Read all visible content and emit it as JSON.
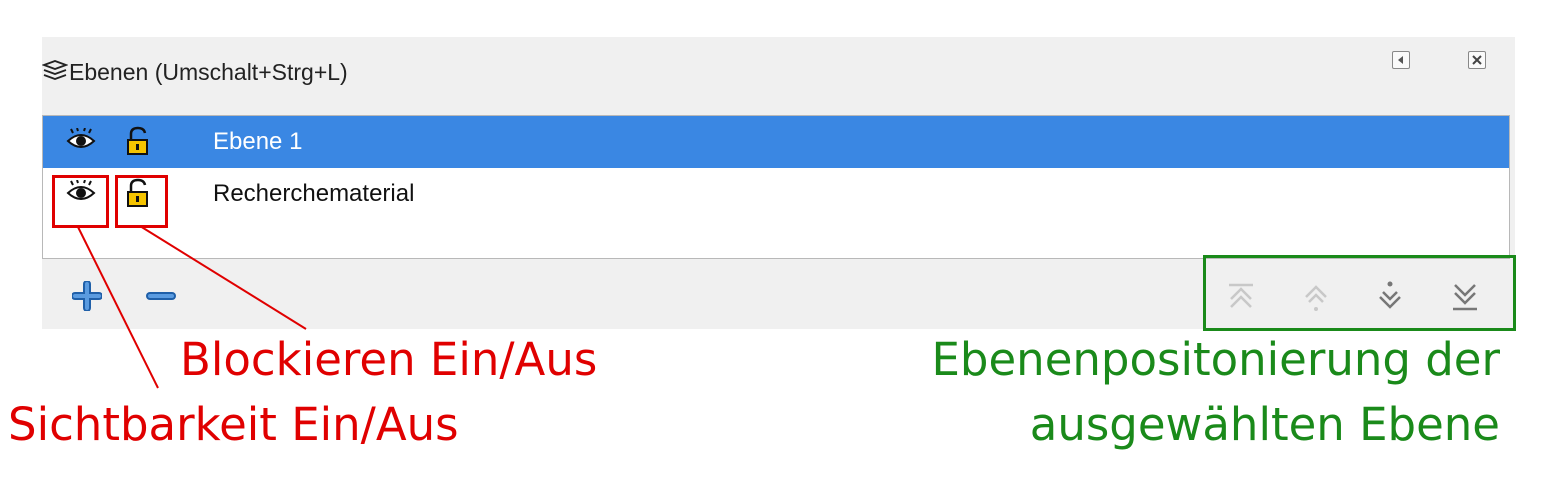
{
  "panel": {
    "title": "Ebenen (Umschalt+Strg+L)",
    "title_icon": "layers-icon",
    "window_buttons": [
      "collapse-icon",
      "close-icon"
    ]
  },
  "layers": [
    {
      "label": "Ebene 1",
      "selected": true,
      "visibility_icon": "eye-icon",
      "lock_icon": "unlocked-padlock-icon"
    },
    {
      "label": "Recherchematerial",
      "selected": false,
      "visibility_icon": "eye-icon",
      "lock_icon": "unlocked-padlock-icon"
    }
  ],
  "toolbar": {
    "add_icon": "plus-icon",
    "remove_icon": "minus-icon",
    "move_icons": [
      "raise-to-top-icon",
      "raise-icon",
      "lower-icon",
      "lower-to-bottom-icon"
    ]
  },
  "annotations": {
    "lock_label": "Blockieren Ein/Aus",
    "visibility_label": "Sichtbarkeit Ein/Aus",
    "position_label_line1": "Ebenenpositonierung der",
    "position_label_line2": "ausgewählten Ebene"
  },
  "colors": {
    "selection": "#3a87e3",
    "annotation_red": "#e00000",
    "annotation_green": "#1a8a1a"
  }
}
